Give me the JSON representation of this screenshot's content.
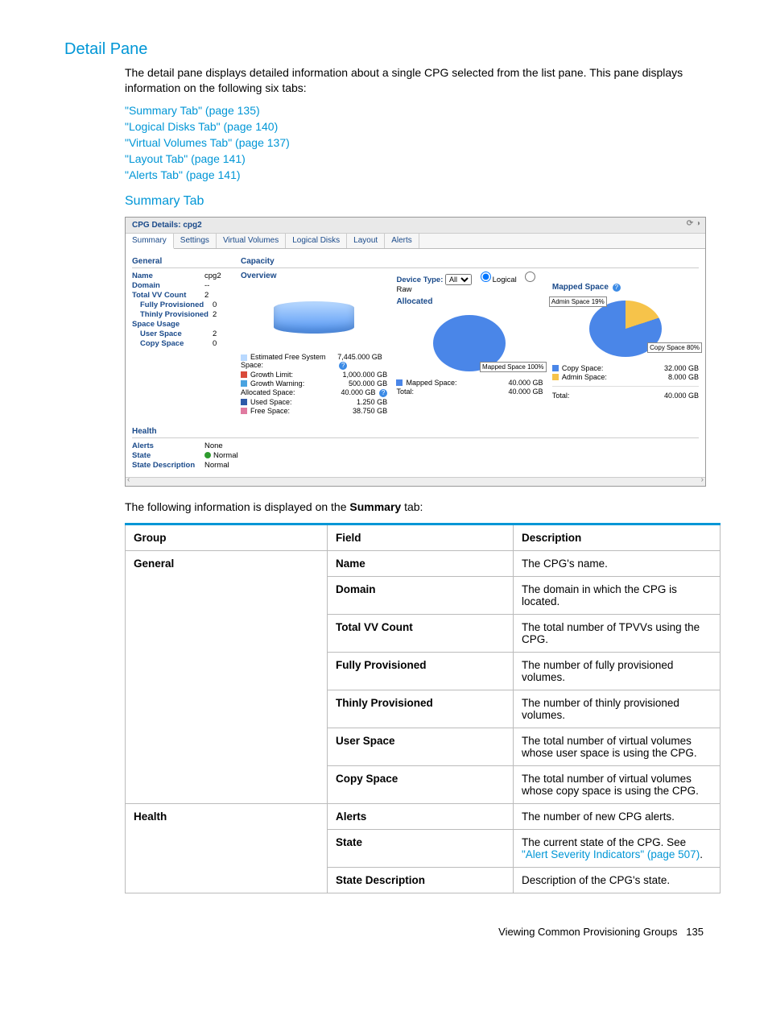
{
  "headings": {
    "detail_pane": "Detail Pane",
    "summary_tab": "Summary Tab"
  },
  "intro1": "The detail pane displays detailed information about a single CPG selected from the list pane. This pane displays information on the following six tabs:",
  "toc": [
    "\"Summary Tab\" (page 135)",
    "\"Logical Disks Tab\" (page 140)",
    "\"Virtual Volumes Tab\" (page 137)",
    "\"Layout Tab\" (page 141)",
    "\"Alerts Tab\" (page 141)"
  ],
  "intro2_pre": "The following information is displayed on the ",
  "intro2_bold": "Summary",
  "intro2_post": " tab:",
  "panel": {
    "title": "CPG Details: cpg2",
    "tabs": [
      "Summary",
      "Settings",
      "Virtual Volumes",
      "Logical Disks",
      "Layout",
      "Alerts"
    ],
    "general_head": "General",
    "capacity_head": "Capacity",
    "overview_head": "Overview",
    "allocated_head": "Allocated",
    "mapped_head": "Mapped Space",
    "general": {
      "Name": "cpg2",
      "Domain": "--",
      "Total VV Count": "2",
      "Fully Provisioned": "0",
      "Thinly Provisioned": "2",
      "Space Usage": "",
      "User Space": "2",
      "Copy Space": "0"
    },
    "device_type_label": "Device Type:",
    "device_type_value": "All",
    "radio_logical": "Logical",
    "radio_raw": "Raw",
    "overview_rows": [
      {
        "swatch": "#b9d9ff",
        "label": "Estimated Free System Space:",
        "value": "7,445.000 GB",
        "info": true
      },
      {
        "swatch": "#d94a3a",
        "label": "Growth Limit:",
        "value": "1,000.000 GB"
      },
      {
        "swatch": "#4aa3e0",
        "label": "Growth Warning:",
        "value": "500.000 GB"
      },
      {
        "swatch": "",
        "label": "Allocated Space:",
        "value": "40.000 GB",
        "info": true
      },
      {
        "swatch": "#2e5aa8",
        "label": "Used Space:",
        "value": "1.250 GB"
      },
      {
        "swatch": "#e07aa0",
        "label": "Free Space:",
        "value": "38.750 GB"
      }
    ],
    "allocated_rows": [
      {
        "swatch": "#4a86e8",
        "label": "Mapped Space:",
        "value": "40.000 GB"
      },
      {
        "swatch": "",
        "label": "Total:",
        "value": "40.000 GB"
      }
    ],
    "allocated_callout": "Mapped Space 100%",
    "mapped_rows": [
      {
        "swatch": "#4a86e8",
        "label": "Copy Space:",
        "value": "32.000 GB"
      },
      {
        "swatch": "#f6c34a",
        "label": "Admin Space:",
        "value": "8.000 GB"
      },
      {
        "swatch": "",
        "label": "Total:",
        "value": "40.000 GB"
      }
    ],
    "mapped_callouts": {
      "admin": "Admin Space 19%",
      "copy": "Copy Space 80%"
    },
    "health_head": "Health",
    "health": {
      "Alerts": "None",
      "State": "Normal",
      "State Description": "Normal"
    }
  },
  "chart_data": [
    {
      "type": "pie",
      "title": "Allocated",
      "series": [
        {
          "name": "Mapped Space",
          "value": 40.0,
          "pct": 100
        }
      ],
      "total": 40.0,
      "unit": "GB"
    },
    {
      "type": "pie",
      "title": "Mapped Space",
      "series": [
        {
          "name": "Copy Space",
          "value": 32.0,
          "pct": 80
        },
        {
          "name": "Admin Space",
          "value": 8.0,
          "pct": 19
        }
      ],
      "total": 40.0,
      "unit": "GB"
    },
    {
      "type": "bar",
      "title": "Overview",
      "categories": [
        "Estimated Free System Space",
        "Growth Limit",
        "Growth Warning",
        "Allocated Space",
        "Used Space",
        "Free Space"
      ],
      "values": [
        7445.0,
        1000.0,
        500.0,
        40.0,
        1.25,
        38.75
      ],
      "unit": "GB"
    }
  ],
  "table": {
    "headers": [
      "Group",
      "Field",
      "Description"
    ],
    "rows": [
      {
        "group": "General",
        "field": "Name",
        "desc": "The CPG's name."
      },
      {
        "group": "",
        "field": "Domain",
        "desc": "The domain in which the CPG is located."
      },
      {
        "group": "",
        "field": "Total VV Count",
        "desc": "The total number of TPVVs using the CPG."
      },
      {
        "group": "",
        "field": "Fully Provisioned",
        "desc": "The number of fully provisioned volumes."
      },
      {
        "group": "",
        "field": "Thinly Provisioned",
        "desc": "The number of thinly provisioned volumes."
      },
      {
        "group": "",
        "field": "User Space",
        "desc": "The total number of virtual volumes whose user space is using the CPG."
      },
      {
        "group": "",
        "field": "Copy Space",
        "desc": "The total number of virtual volumes whose copy space is using the CPG."
      },
      {
        "group": "Health",
        "field": "Alerts",
        "desc": "The number of new CPG alerts."
      },
      {
        "group": "",
        "field": "State",
        "desc_pre": "The current state of the CPG. See ",
        "link": "\"Alert Severity Indicators\" (page 507)",
        "desc_post": "."
      },
      {
        "group": "",
        "field": "State Description",
        "desc": "Description of the CPG's state."
      }
    ]
  },
  "footer": {
    "text": "Viewing Common Provisioning Groups",
    "page": "135"
  }
}
